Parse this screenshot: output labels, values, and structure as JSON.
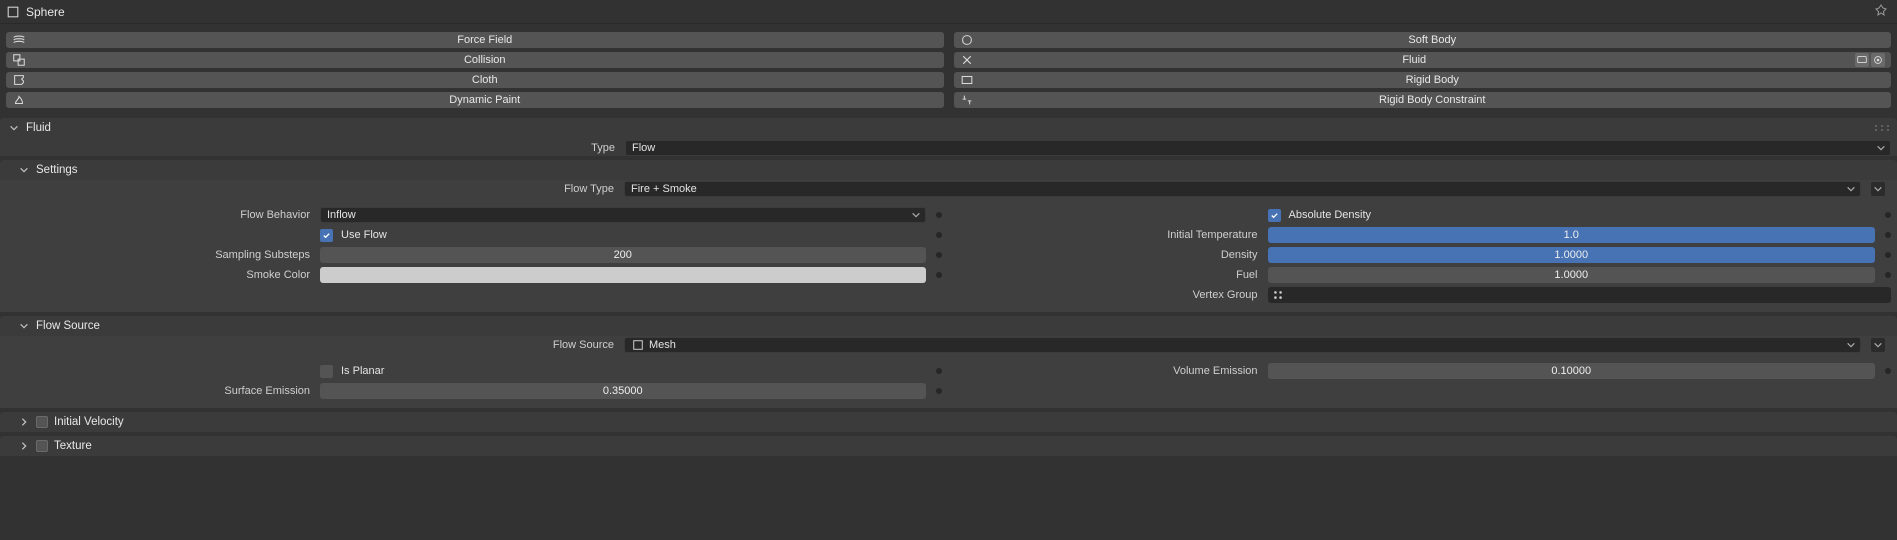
{
  "header": {
    "object_name": "Sphere"
  },
  "physics_buttons": {
    "left": [
      "Force Field",
      "Collision",
      "Cloth",
      "Dynamic Paint"
    ],
    "right": [
      "Soft Body",
      "Fluid",
      "Rigid Body",
      "Rigid Body Constraint"
    ]
  },
  "fluid_panel": {
    "title": "Fluid",
    "type_label": "Type",
    "type_value": "Flow"
  },
  "settings_panel": {
    "title": "Settings",
    "flow_type_label": "Flow Type",
    "flow_type_value": "Fire + Smoke",
    "left": {
      "flow_behavior_label": "Flow Behavior",
      "flow_behavior_value": "Inflow",
      "use_flow_label": "Use Flow",
      "use_flow_checked": true,
      "sampling_label": "Sampling Substeps",
      "sampling_value": "200",
      "smoke_color_label": "Smoke Color",
      "smoke_color_value": "#cccccc"
    },
    "right": {
      "abs_density_label": "Absolute Density",
      "abs_density_checked": true,
      "init_temp_label": "Initial Temperature",
      "init_temp_value": "1.0",
      "density_label": "Density",
      "density_value": "1.0000",
      "fuel_label": "Fuel",
      "fuel_value": "1.0000",
      "vertex_group_label": "Vertex Group",
      "vertex_group_value": ""
    }
  },
  "flow_source_panel": {
    "title": "Flow Source",
    "source_label": "Flow Source",
    "source_value": "Mesh",
    "left": {
      "is_planar_label": "Is Planar",
      "is_planar_checked": false,
      "surface_emission_label": "Surface Emission",
      "surface_emission_value": "0.35000"
    },
    "right": {
      "volume_emission_label": "Volume Emission",
      "volume_emission_value": "0.10000"
    }
  },
  "subpanels": {
    "initial_velocity": "Initial Velocity",
    "texture": "Texture"
  }
}
